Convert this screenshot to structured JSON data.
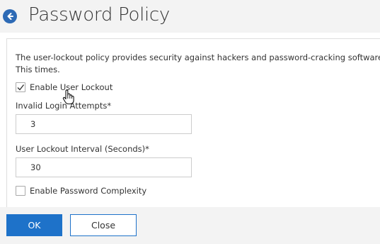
{
  "header": {
    "title": "Password Policy",
    "back_icon": "arrow-left-circle-icon"
  },
  "form": {
    "description": "The user-lockout policy provides security against hackers and password-cracking software. This times.",
    "enable_user_lockout": {
      "label": "Enable User Lockout",
      "checked": true
    },
    "invalid_login_attempts": {
      "label": "Invalid Login Attempts*",
      "value": "3"
    },
    "user_lockout_interval": {
      "label": "User Lockout Interval (Seconds)*",
      "value": "30"
    },
    "enable_password_complexity": {
      "label": "Enable Password Complexity",
      "checked": false
    }
  },
  "footer": {
    "ok_label": "OK",
    "close_label": "Close"
  },
  "colors": {
    "accent": "#1e72c9",
    "header_bg": "#f3f3f3",
    "back_icon_bg": "#2d6ab5"
  }
}
